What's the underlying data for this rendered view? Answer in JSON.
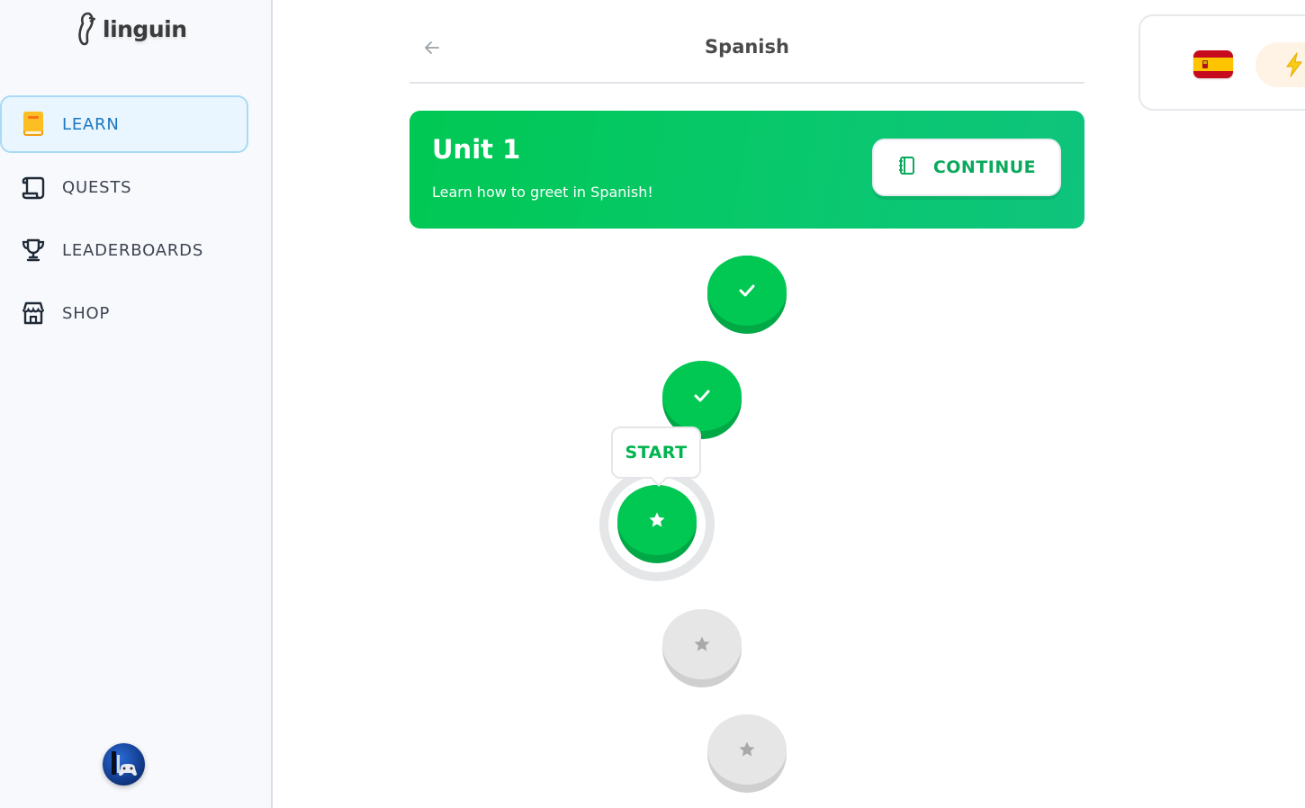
{
  "app": {
    "logo_text": "linguin"
  },
  "sidebar": {
    "items": [
      {
        "label": "LEARN",
        "icon": "book-icon",
        "active": true
      },
      {
        "label": "QUESTS",
        "icon": "scroll-icon",
        "active": false
      },
      {
        "label": "LEADERBOARDS",
        "icon": "trophy-icon",
        "active": false
      },
      {
        "label": "SHOP",
        "icon": "store-icon",
        "active": false
      }
    ],
    "avatar_icon": "game-controller-avatar"
  },
  "header": {
    "title": "Spanish",
    "back_icon": "arrow-left-icon"
  },
  "unit": {
    "title": "Unit 1",
    "subtitle": "Learn how to greet in Spanish!",
    "continue_label": "CONTINUE",
    "continue_icon": "notebook-icon"
  },
  "path": {
    "start_label": "START",
    "lessons": [
      {
        "status": "completed",
        "icon": "check-icon"
      },
      {
        "status": "completed",
        "icon": "check-icon"
      },
      {
        "status": "current",
        "icon": "star-icon"
      },
      {
        "status": "locked",
        "icon": "star-icon"
      },
      {
        "status": "locked",
        "icon": "star-icon"
      }
    ]
  },
  "right_panel": {
    "language_flag": "spain-flag-icon",
    "energy_icon": "lightning-icon"
  },
  "colors": {
    "primary_green": "#00c853",
    "active_nav_bg": "#e9f5ff",
    "active_nav_text": "#1a78c2",
    "locked_gray": "#e6e6e6"
  }
}
